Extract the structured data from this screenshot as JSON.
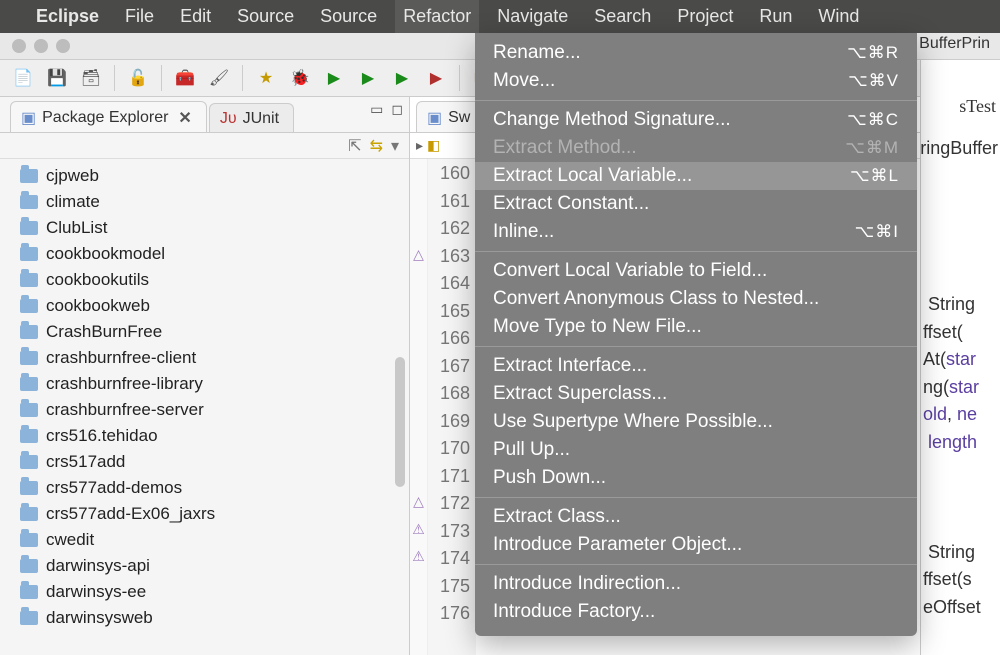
{
  "menubar": {
    "app": "Eclipse",
    "items": [
      "File",
      "Edit",
      "Source",
      "Source",
      "Refactor",
      "Navigate",
      "Search",
      "Project",
      "Run",
      "Wind"
    ],
    "selected": "Refactor"
  },
  "window": {
    "title_fragment_right": "BufferPrin"
  },
  "sidebar": {
    "tabs": {
      "explorer_label": "Package Explorer",
      "junit_label": "JUnit"
    },
    "projects": [
      "cjpweb",
      "climate",
      "ClubList",
      "cookbookmodel",
      "cookbookutils",
      "cookbookweb",
      "CrashBurnFree",
      "crashburnfree-client",
      "crashburnfree-library",
      "crashburnfree-server",
      "crs516.tehidao",
      "crs517add",
      "crs577add-demos",
      "crs577add-Ex06_jaxrs",
      "cwedit",
      "darwinsys-api",
      "darwinsys-ee",
      "darwinsysweb"
    ]
  },
  "editor": {
    "tab_fragment": "Sw",
    "right_tab_fragment": "sTest",
    "breadcrumb_fragment": "ringBuffer",
    "line_start": 160,
    "line_count": 17,
    "markers": {
      "163": "△",
      "172": "△",
      "173": "⚠",
      "174": "⚠"
    },
    "right_code_fragments": [
      " String",
      "ffset(",
      "At(star",
      "ng(star",
      "old, ne",
      " length",
      "",
      "",
      "",
      " String",
      "ffset(s",
      "eOffset"
    ]
  },
  "refactor_menu": [
    {
      "label": "Rename...",
      "shortcut": "⌥⌘R"
    },
    {
      "label": "Move...",
      "shortcut": "⌥⌘V"
    },
    {
      "sep": true
    },
    {
      "label": "Change Method Signature...",
      "shortcut": "⌥⌘C"
    },
    {
      "label": "Extract Method...",
      "shortcut": "⌥⌘M",
      "disabled": true
    },
    {
      "label": "Extract Local Variable...",
      "shortcut": "⌥⌘L",
      "highlight": true
    },
    {
      "label": "Extract Constant..."
    },
    {
      "label": "Inline...",
      "shortcut": "⌥⌘I"
    },
    {
      "sep": true
    },
    {
      "label": "Convert Local Variable to Field..."
    },
    {
      "label": "Convert Anonymous Class to Nested..."
    },
    {
      "label": "Move Type to New File..."
    },
    {
      "sep": true
    },
    {
      "label": "Extract Interface..."
    },
    {
      "label": "Extract Superclass..."
    },
    {
      "label": "Use Supertype Where Possible..."
    },
    {
      "label": "Pull Up..."
    },
    {
      "label": "Push Down..."
    },
    {
      "sep": true
    },
    {
      "label": "Extract Class..."
    },
    {
      "label": "Introduce Parameter Object..."
    },
    {
      "sep": true
    },
    {
      "label": "Introduce Indirection..."
    },
    {
      "label": "Introduce Factory..."
    }
  ]
}
